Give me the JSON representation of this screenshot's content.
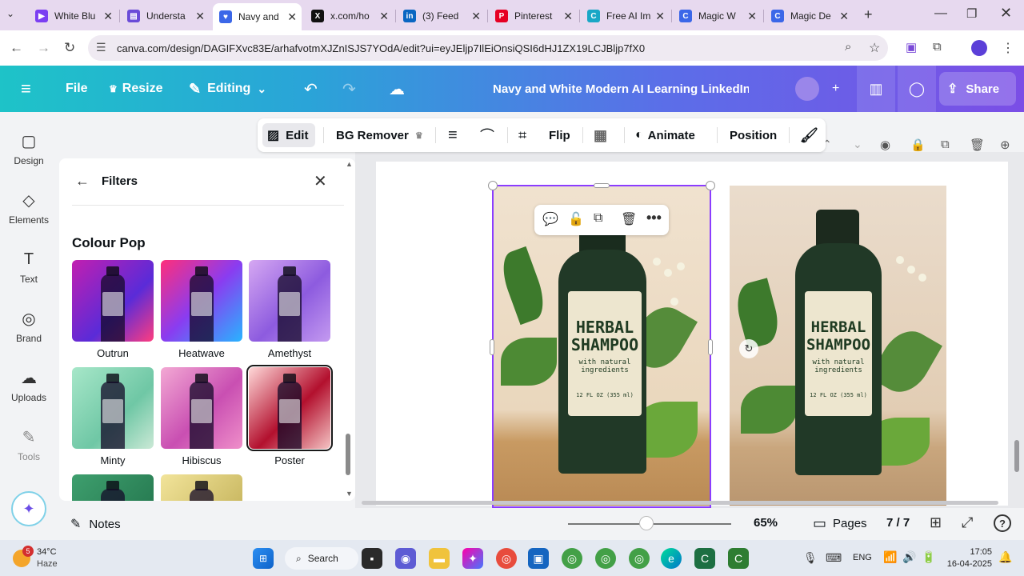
{
  "browser": {
    "tabs": [
      {
        "title": "White Blu",
        "color": "#7b3ff2",
        "glyph": "▶"
      },
      {
        "title": "Understa",
        "color": "#6a4bd8",
        "glyph": "▤"
      },
      {
        "title": "Navy and",
        "color": "#3b67e8",
        "glyph": "♥"
      },
      {
        "title": "x.com/ho",
        "color": "#111111",
        "glyph": "X"
      },
      {
        "title": "(3) Feed",
        "color": "#0a66c2",
        "glyph": "in"
      },
      {
        "title": "Pinterest",
        "color": "#e60023",
        "glyph": "P"
      },
      {
        "title": "Free AI Im",
        "color": "#19a7c6",
        "glyph": "C"
      },
      {
        "title": "Magic W",
        "color": "#3b67e8",
        "glyph": "C"
      },
      {
        "title": "Magic De",
        "color": "#3b67e8",
        "glyph": "C"
      }
    ],
    "new_tab": "+",
    "url": "canva.com/design/DAGIFXvc83E/arhafvotmXJZnISJS7YOdA/edit?ui=eyJEljp7IlEiOnsiQSI6dHJ1ZX19LCJBljp7fX0"
  },
  "header": {
    "file": "File",
    "resize": "Resize",
    "editing": "Editing",
    "title": "Navy and White Modern AI Learning LinkedIn Post",
    "share": "Share"
  },
  "rail": [
    {
      "label": "Design",
      "icon": "design-icon",
      "glyph": "▢"
    },
    {
      "label": "Elements",
      "icon": "elements-icon",
      "glyph": "◇"
    },
    {
      "label": "Text",
      "icon": "text-icon",
      "glyph": "T"
    },
    {
      "label": "Brand",
      "icon": "brand-icon",
      "glyph": "◎"
    },
    {
      "label": "Uploads",
      "icon": "uploads-icon",
      "glyph": "☁"
    },
    {
      "label": "Tools",
      "icon": "tools-icon",
      "glyph": "✎"
    }
  ],
  "panel": {
    "title": "Filters",
    "section": "Colour Pop",
    "filters": [
      {
        "name": "Outrun",
        "bg": "linear-gradient(135deg,#c21fb0,#5a2bd8 60%,#ff3d7f)"
      },
      {
        "name": "Heatwave",
        "bg": "linear-gradient(135deg,#ff2f7a,#8a3cf0 50%,#28b4ff)"
      },
      {
        "name": "Amethyst",
        "bg": "linear-gradient(135deg,#d6a8f2,#8d5bdf 55%,#c49af0)"
      },
      {
        "name": "Minty",
        "bg": "linear-gradient(135deg,#a7e7c9,#6fc7a5 60%,#cbe9d6)"
      },
      {
        "name": "Hibiscus",
        "bg": "linear-gradient(135deg,#f3a9d4,#c94fb2 55%,#ef8fc9)"
      },
      {
        "name": "Poster",
        "bg": "linear-gradient(135deg,#ffd9d9,#b3102e 55%,#f4c4c4)"
      },
      {
        "name": "",
        "bg": "linear-gradient(135deg,#3e9f6e,#1d6b45)"
      },
      {
        "name": "",
        "bg": "linear-gradient(135deg,#f2e49a,#b7a448)"
      }
    ]
  },
  "toolbar": {
    "edit": "Edit",
    "bg_remover": "BG Remover",
    "flip": "Flip",
    "animate": "Animate",
    "position": "Position"
  },
  "product": {
    "line1": "HERBAL",
    "line2": "SHAMPOO",
    "sub1": "with natural",
    "sub2": "ingredients",
    "size": "12 FL OZ (355 ml)"
  },
  "bottom": {
    "notes": "Notes",
    "zoom": "65%",
    "pages": "Pages",
    "page_count": "7 / 7"
  },
  "taskbar": {
    "temp": "34°C",
    "weather": "Haze",
    "search": "Search",
    "lang": "ENG",
    "time": "17:05",
    "date": "16-04-2025",
    "badge": "5"
  }
}
